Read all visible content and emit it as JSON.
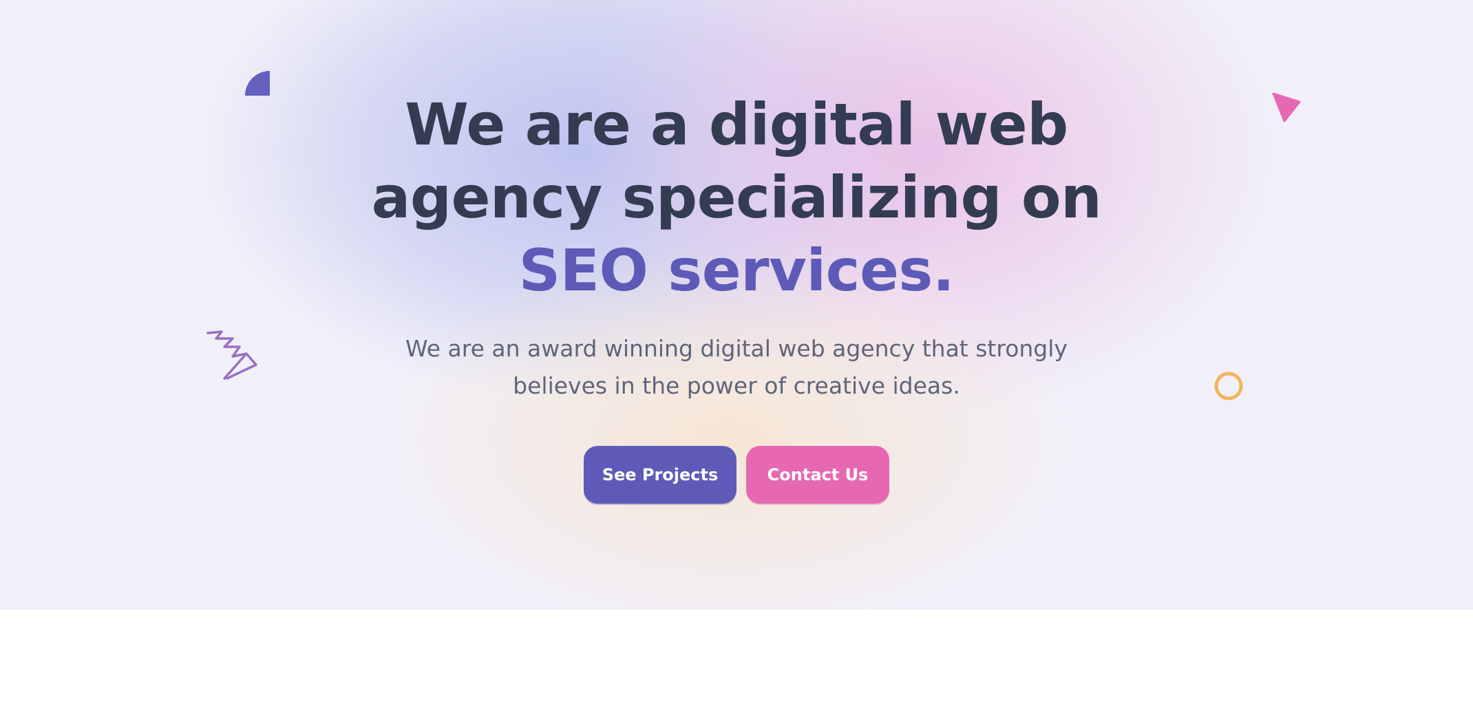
{
  "hero": {
    "heading_line1": "We are a digital web",
    "heading_line2": "agency specializing on",
    "heading_accent": "SEO services.",
    "subtext_line1": "We are an award winning digital web agency that strongly",
    "subtext_line2": "believes in the power of creative ideas."
  },
  "buttons": {
    "primary_label": "See Projects",
    "secondary_label": "Contact Us"
  },
  "colors": {
    "heading": "#343c52",
    "accent": "#5d5bb7",
    "primary_button": "#5e5bb8",
    "secondary_button": "#e668b2",
    "ring": "#f4b45a",
    "squiggle": "#9a6fc0",
    "triangle": "#e668b2"
  },
  "decorations": [
    "quarter-circle-icon",
    "squiggle-icon",
    "triangle-icon",
    "ring-icon"
  ]
}
